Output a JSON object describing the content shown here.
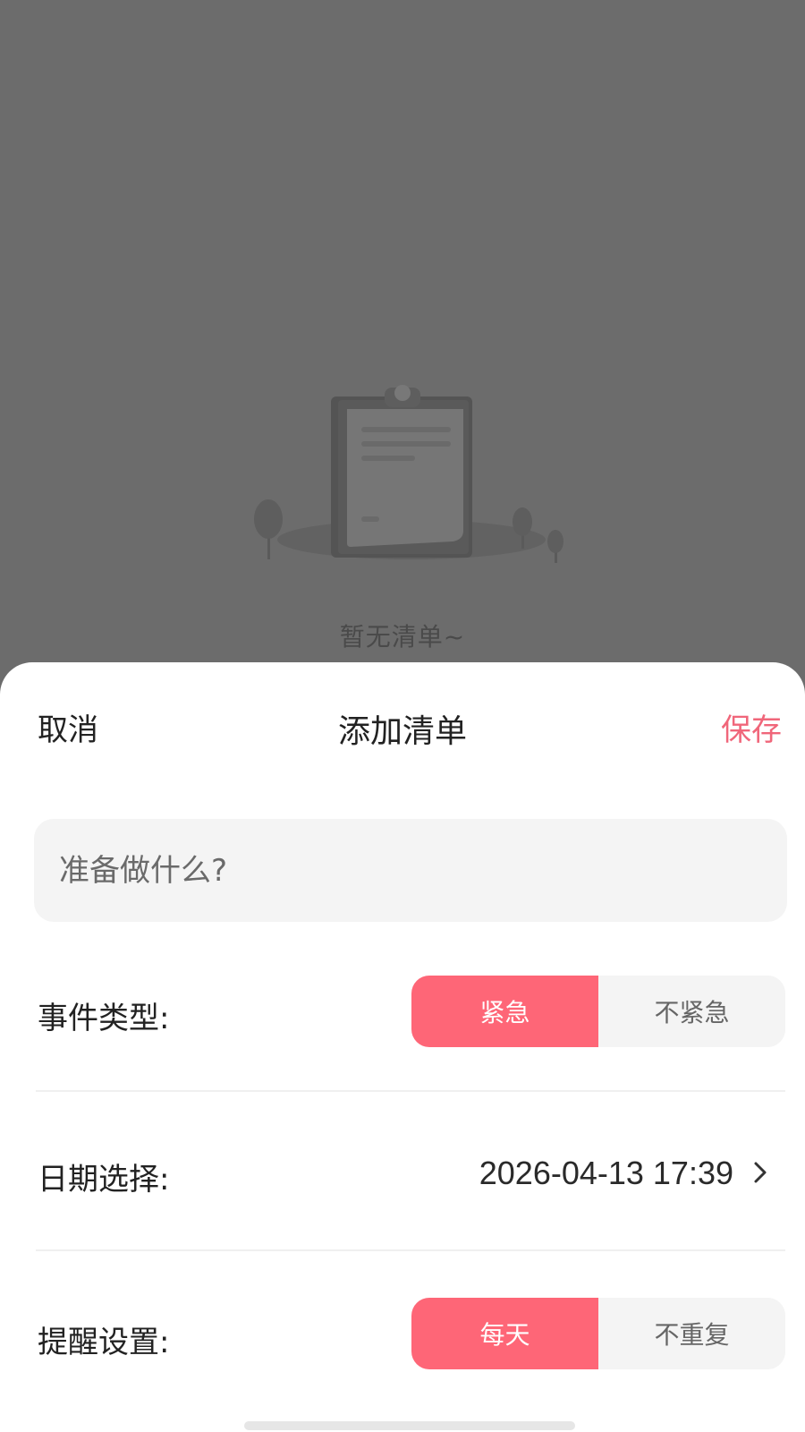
{
  "background": {
    "empty_message": "暂无清单~",
    "illustration_icon": "clipboard-empty-illustration"
  },
  "sheet": {
    "cancel_label": "取消",
    "title": "添加清单",
    "save_label": "保存",
    "input_placeholder": "准备做什么?",
    "input_value": "",
    "event_type": {
      "label": "事件类型:",
      "options": [
        "紧急",
        "不紧急"
      ],
      "selected": "紧急"
    },
    "date": {
      "label": "日期选择:",
      "value": "2026-04-13 17:39",
      "icon": "chevron-right-icon"
    },
    "reminder": {
      "label": "提醒设置:",
      "options": [
        "每天",
        "不重复"
      ],
      "selected": "每天"
    }
  },
  "colors": {
    "accent": "#fe6677",
    "save_text": "#f0667a",
    "overlay": "#6c6c6c"
  }
}
